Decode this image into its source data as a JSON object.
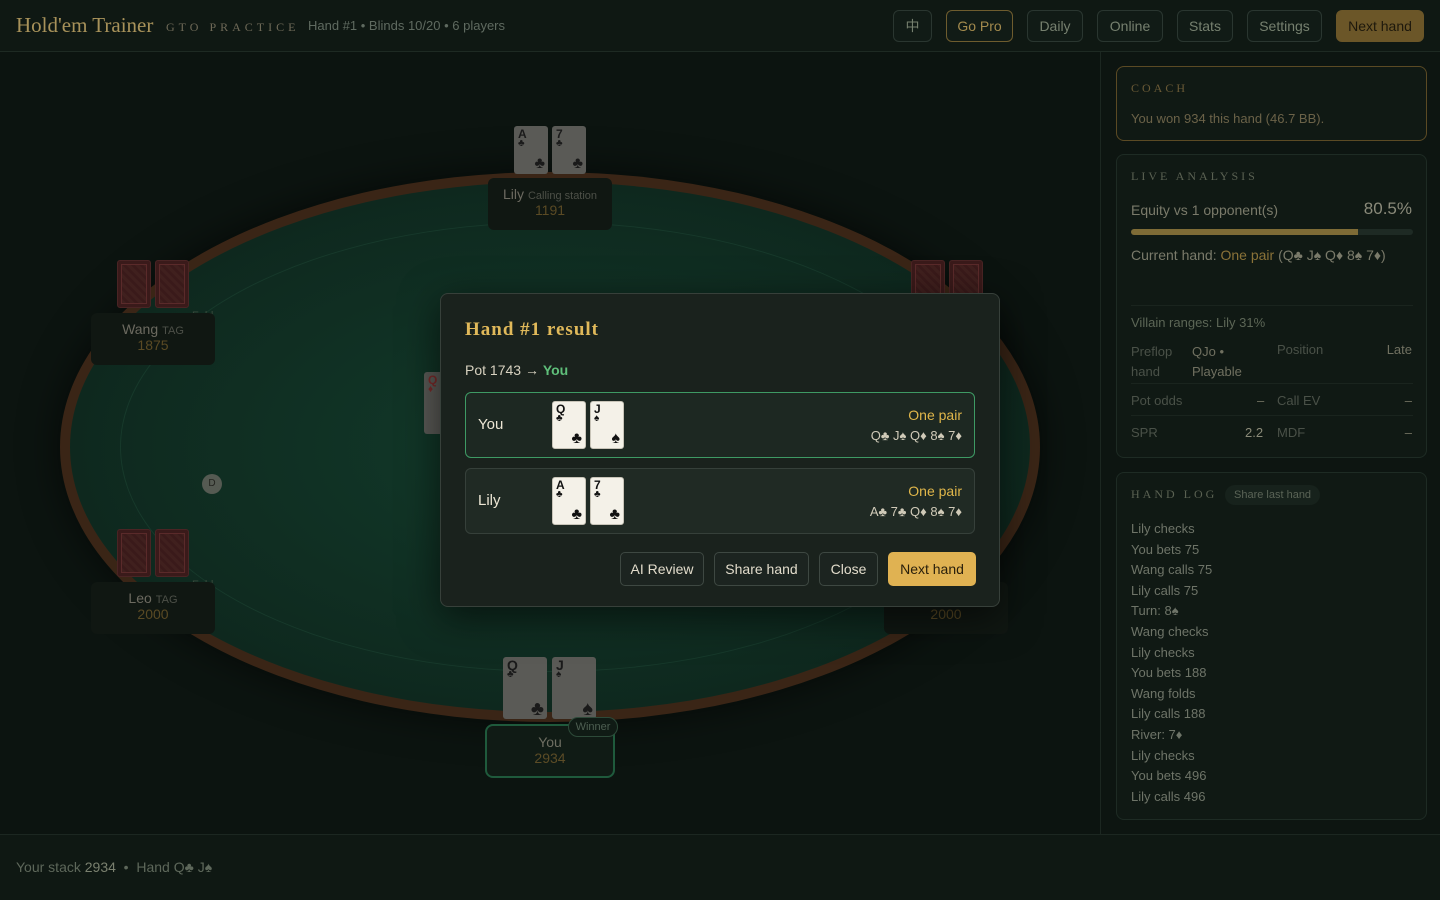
{
  "header": {
    "brand": "Hold'em Trainer",
    "brand_sub": "GTO PRACTICE",
    "hand_info": "Hand #1  •  Blinds 10/20  •  6 players",
    "lang_label": "中",
    "go_pro": "Go Pro",
    "daily": "Daily",
    "online": "Online",
    "stats": "Stats",
    "settings": "Settings",
    "next_hand": "Next hand"
  },
  "table": {
    "dealer_label": "D",
    "lily": {
      "name": "Lily",
      "tag": "Calling station",
      "stack": "1191",
      "card1_rank": "A",
      "card1_suit": "♣",
      "card2_rank": "7",
      "card2_suit": "♣"
    },
    "wang": {
      "name": "Wang",
      "tag": "TAG",
      "stack": "1875",
      "status": "Fold"
    },
    "leo": {
      "name": "Leo",
      "tag": "TAG",
      "stack": "2000",
      "status": "Fold"
    },
    "right_bottom": {
      "stack": "2000"
    },
    "board_card_peek": {
      "rank": "Q",
      "suit": "♦"
    },
    "you": {
      "name": "You",
      "stack": "2934",
      "badge": "Winner",
      "card1_rank": "Q",
      "card1_suit": "♣",
      "card2_rank": "J",
      "card2_suit": "♠"
    }
  },
  "panel": {
    "coach": {
      "title": "COACH",
      "text": "You won 934 this hand (46.7 BB)."
    },
    "analysis": {
      "title": "LIVE ANALYSIS",
      "equity_label": "Equity vs 1 opponent(s)",
      "equity_value": "80.5%",
      "equity_fraction": 0.805,
      "current_hand_prefix": "Current hand: ",
      "current_hand_rank": "One pair",
      "current_hand_cards": " (Q♣ J♠ Q♦ 8♠ 7♦)",
      "ranges": "Villain ranges: Lily 31%",
      "preflop_label": "Preflop hand",
      "preflop_value": "QJo  •  Playable",
      "position_label": "Position",
      "position_value": "Late",
      "pot_odds_label": "Pot odds",
      "pot_odds_value": "–",
      "call_ev_label": "Call EV",
      "call_ev_value": "–",
      "spr_label": "SPR",
      "spr_value": "2.2",
      "mdf_label": "MDF",
      "mdf_value": "–"
    },
    "log": {
      "title": "HAND LOG",
      "share_last": "Share last hand",
      "entries": [
        "Lily checks",
        "You bets 75",
        "Wang calls 75",
        "Lily calls 75",
        "Turn: 8♠",
        "Wang checks",
        "Lily checks",
        "You bets 188",
        "Wang folds",
        "Lily calls 188",
        "River: 7♦",
        "Lily checks",
        "You bets 496",
        "Lily calls 496"
      ]
    }
  },
  "footer": {
    "stack_label": "Your stack",
    "stack_value": "2934",
    "hand_label": "Hand",
    "hand_value": "Q♣ J♠"
  },
  "modal": {
    "title": "Hand #1 result",
    "pot_text": "Pot 1743 → ",
    "pot_winner": "You",
    "rows": [
      {
        "name": "You",
        "c1r": "Q",
        "c1s": "♣",
        "c2r": "J",
        "c2s": "♠",
        "rank": "One pair",
        "best": "Q♣ J♠ Q♦ 8♠ 7♦"
      },
      {
        "name": "Lily",
        "c1r": "A",
        "c1s": "♣",
        "c2r": "7",
        "c2s": "♣",
        "rank": "One pair",
        "best": "A♣ 7♣ Q♦ 8♠ 7♦"
      }
    ],
    "ai_review": "AI Review",
    "share_hand": "Share hand",
    "close": "Close",
    "next_hand": "Next hand"
  }
}
